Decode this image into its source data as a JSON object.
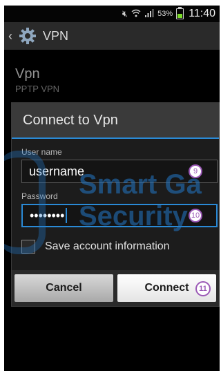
{
  "status_bar": {
    "battery_pct": "53%",
    "time": "11:40",
    "icons": [
      "mute-icon",
      "wifi-icon",
      "signal-icon",
      "battery-icon"
    ],
    "battery_level": 0.53,
    "battery_color": "#7cdc2a"
  },
  "action_bar": {
    "title": "VPN",
    "icons": [
      "back-icon",
      "gear-icon"
    ]
  },
  "vpn_entry": {
    "name": "Vpn",
    "type": "PPTP VPN"
  },
  "dialog": {
    "title": "Connect to Vpn",
    "username_label": "User name",
    "username_value": "username",
    "password_label": "Password",
    "password_value": "••••••••",
    "save_label": "Save account information",
    "save_checked": false,
    "cancel_label": "Cancel",
    "connect_label": "Connect",
    "accent_color": "#2a8ad6"
  },
  "badges": {
    "username": "9",
    "password": "10",
    "connect": "11",
    "color": "#9b59b6"
  },
  "watermark": {
    "line1": "Smart Ga",
    "line2": "Security"
  }
}
